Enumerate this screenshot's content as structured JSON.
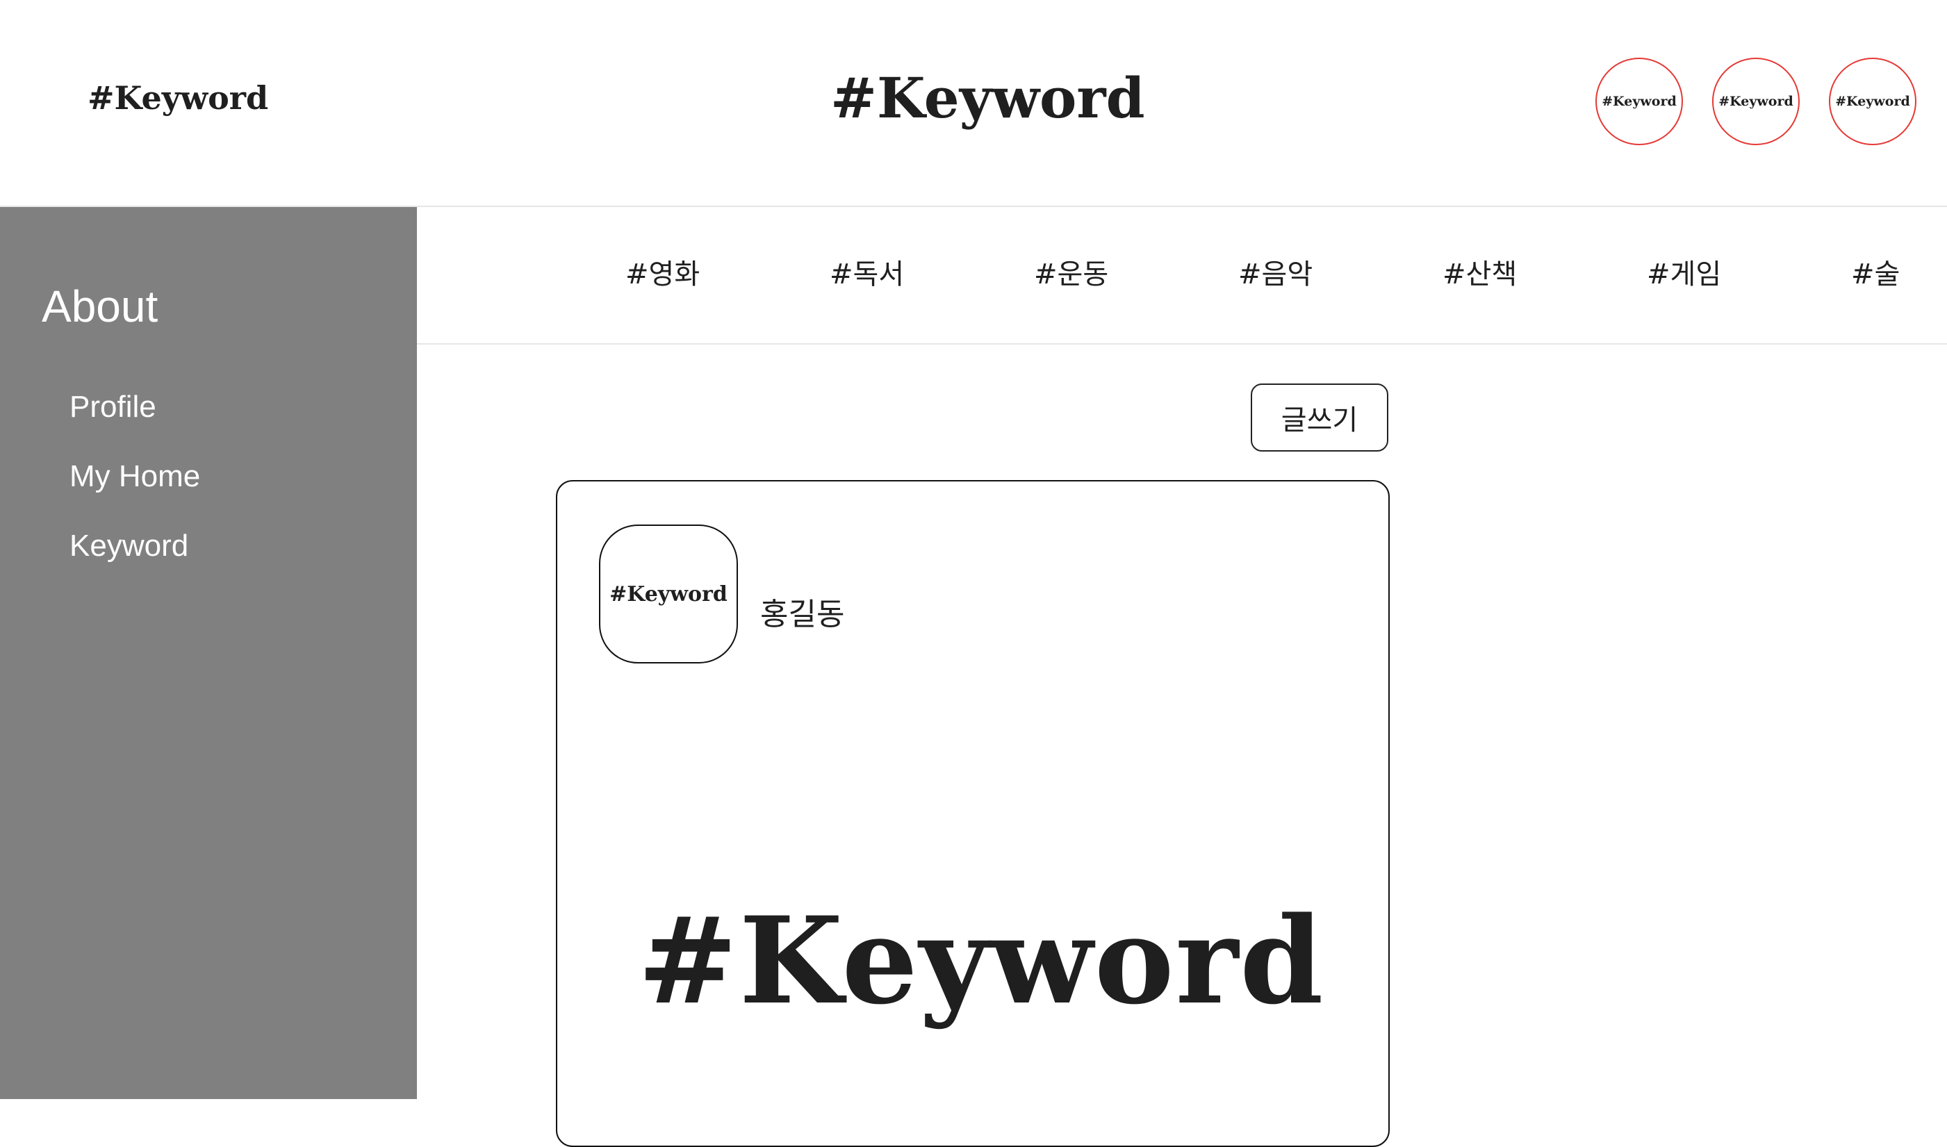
{
  "header": {
    "logo_small": "#Keyword",
    "logo_main": "#Keyword",
    "circles": [
      "#Keyword",
      "#Keyword",
      "#Keyword"
    ]
  },
  "sidebar": {
    "title": "About",
    "items": [
      "Profile",
      "My Home",
      "Keyword"
    ]
  },
  "categories": [
    "#영화",
    "#독서",
    "#운동",
    "#음악",
    "#산책",
    "#게임",
    "#술"
  ],
  "toolbar": {
    "write_label": "글쓰기"
  },
  "post": {
    "avatar_text": "#Keyword",
    "author": "홍길동",
    "image_text": "#Keyword"
  },
  "colors": {
    "sidebar_bg": "#808080",
    "circle_border": "#e53935",
    "divider": "#e6e6e6"
  }
}
